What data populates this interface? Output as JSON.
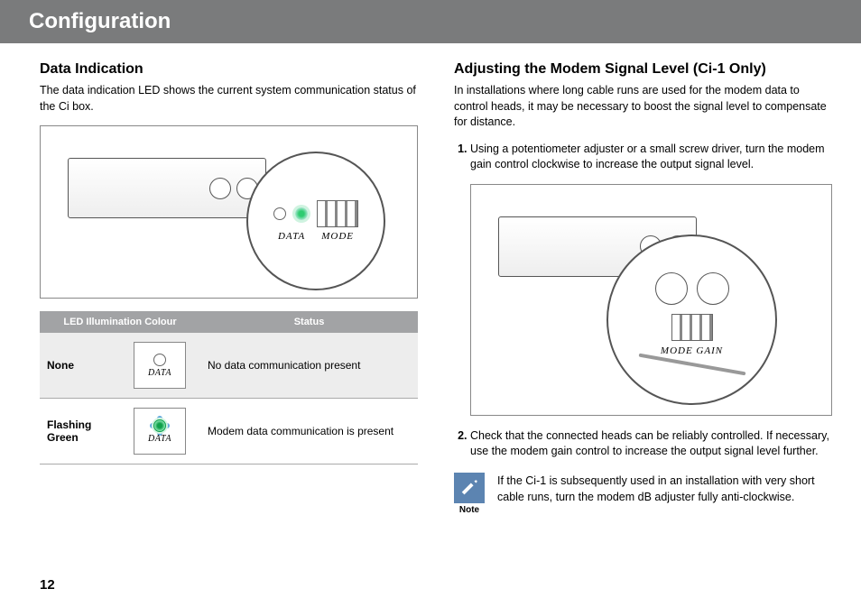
{
  "header": {
    "title": "Configuration"
  },
  "page_number": "12",
  "left": {
    "heading": "Data Indication",
    "intro": "The data indication LED shows the current system communication status of the Ci box.",
    "figure_magnifier_label": "DATA",
    "figure_magnifier_label2": "MODE",
    "table": {
      "headers": [
        "LED Illumination Colour",
        "Status"
      ],
      "rows": [
        {
          "label": "None",
          "icon_label": "DATA",
          "status": "No data communication present"
        },
        {
          "label": "Flashing Green",
          "icon_label": "DATA",
          "status": "Modem data communication is present"
        }
      ]
    }
  },
  "right": {
    "heading": "Adjusting the Modem Signal Level (Ci-1 Only)",
    "intro": "In installations where long cable runs are used for the modem data to control heads, it may be necessary to boost the signal level to compensate for distance.",
    "steps": [
      "Using a potentiometer adjuster or a small screw driver, turn the modem gain control clockwise to increase the output signal level.",
      "Check that the connected heads can be reliably controlled. If necessary, use the modem gain control to increase the output signal level further."
    ],
    "figure_magnifier_label": "MODE GAIN",
    "note": {
      "label": "Note",
      "text": "If the Ci-1 is subsequently used in an installation with very short cable runs, turn the modem dB adjuster fully anti-clockwise."
    }
  }
}
